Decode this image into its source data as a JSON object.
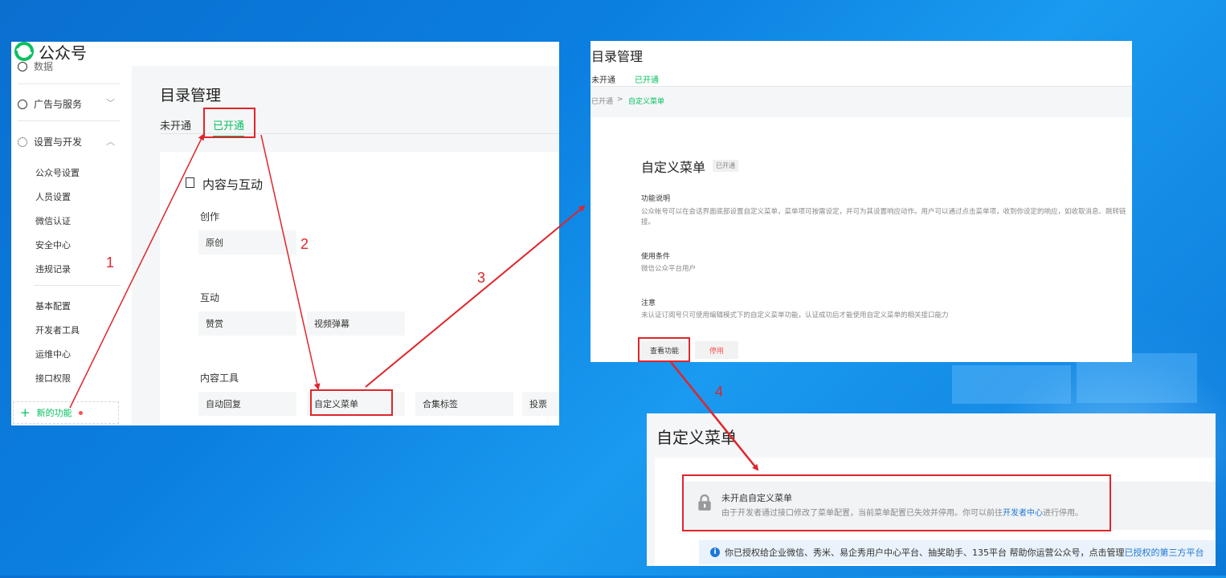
{
  "panelA": {
    "app_name": "公众号",
    "cut_item": "数据",
    "groups": [
      {
        "label": "广告与服务"
      },
      {
        "label": "设置与开发"
      }
    ],
    "settings_items": [
      "公众号设置",
      "人员设置",
      "微信认证",
      "安全中心",
      "违规记录"
    ],
    "dev_items": [
      "基本配置",
      "开发者工具",
      "运维中心",
      "接口权限"
    ],
    "new_feature": "新的功能",
    "page_title": "目录管理",
    "tabs": [
      "未开通",
      "已开通"
    ],
    "card_title": "内容与互动",
    "sections": [
      {
        "title": "创作",
        "items": [
          "原创"
        ]
      },
      {
        "title": "互动",
        "items": [
          "赞赏",
          "视频弹幕"
        ]
      },
      {
        "title": "内容工具",
        "items": [
          "自动回复",
          "自定义菜单",
          "合集标签",
          "投票"
        ]
      }
    ]
  },
  "panelB": {
    "page_title": "目录管理",
    "tabs": [
      "未开通",
      "已开通"
    ],
    "breadcrumb": [
      "已开通",
      ">",
      "自定义菜单"
    ],
    "feature_title": "自定义菜单",
    "badge": "已开通",
    "desc_title": "功能说明",
    "desc_text": "公众帐号可以在会话界面底部设置自定义菜单，菜单项可按需设定，并可为其设置响应动作。用户可以通过点击菜单项，收到你设定的响应，如收取消息、跳转链接。",
    "cond_title": "使用条件",
    "cond_text": "微信公众平台用户",
    "note_title": "注意",
    "note_text": "未认证订阅号只可使用编辑模式下的自定义菜单功能，认证成功后才能使用自定义菜单的相关接口能力",
    "view_button": "查看功能",
    "stop_button": "停用"
  },
  "panelC": {
    "title": "自定义菜单",
    "lock_title": "未开启自定义菜单",
    "lock_text_1": "由于开发者通过接口修改了菜单配置，当前菜单配置已失效并停用。你可以前往",
    "lock_link": "开发者中心",
    "lock_text_2": "进行停用。",
    "info_text_1": "你已授权给企业微信、秀米、易企秀用户中心平台、抽奖助手、135平台  帮助你运营公众号，点击管理",
    "info_link": "已授权的第三方平台"
  },
  "annotations": [
    "1",
    "2",
    "3",
    "4"
  ],
  "colors": {
    "accent": "#07c160",
    "annotation": "#e0252a",
    "link": "#1e78d6"
  }
}
